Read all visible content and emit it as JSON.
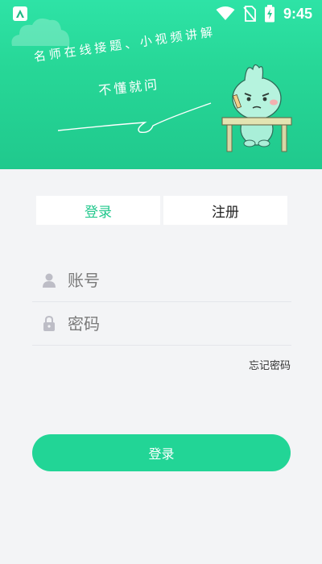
{
  "status_bar": {
    "time": "9:45",
    "icons": [
      "app-icon",
      "wifi-icon",
      "no-sim-icon",
      "battery-charging-icon"
    ]
  },
  "hero": {
    "slogan_line1": "名师在线接题、小视频讲解",
    "slogan_line2": "不懂就问",
    "illustration": "mascot-studying-at-desk"
  },
  "tabs": [
    {
      "label": "登录",
      "active": true
    },
    {
      "label": "注册",
      "active": false
    }
  ],
  "form": {
    "account_placeholder": "账号",
    "password_placeholder": "密码",
    "forgot_label": "忘记密码",
    "submit_label": "登录"
  },
  "colors": {
    "accent": "#22d596",
    "tab_active_text": "#22c88d",
    "background": "#f3f4f6"
  }
}
